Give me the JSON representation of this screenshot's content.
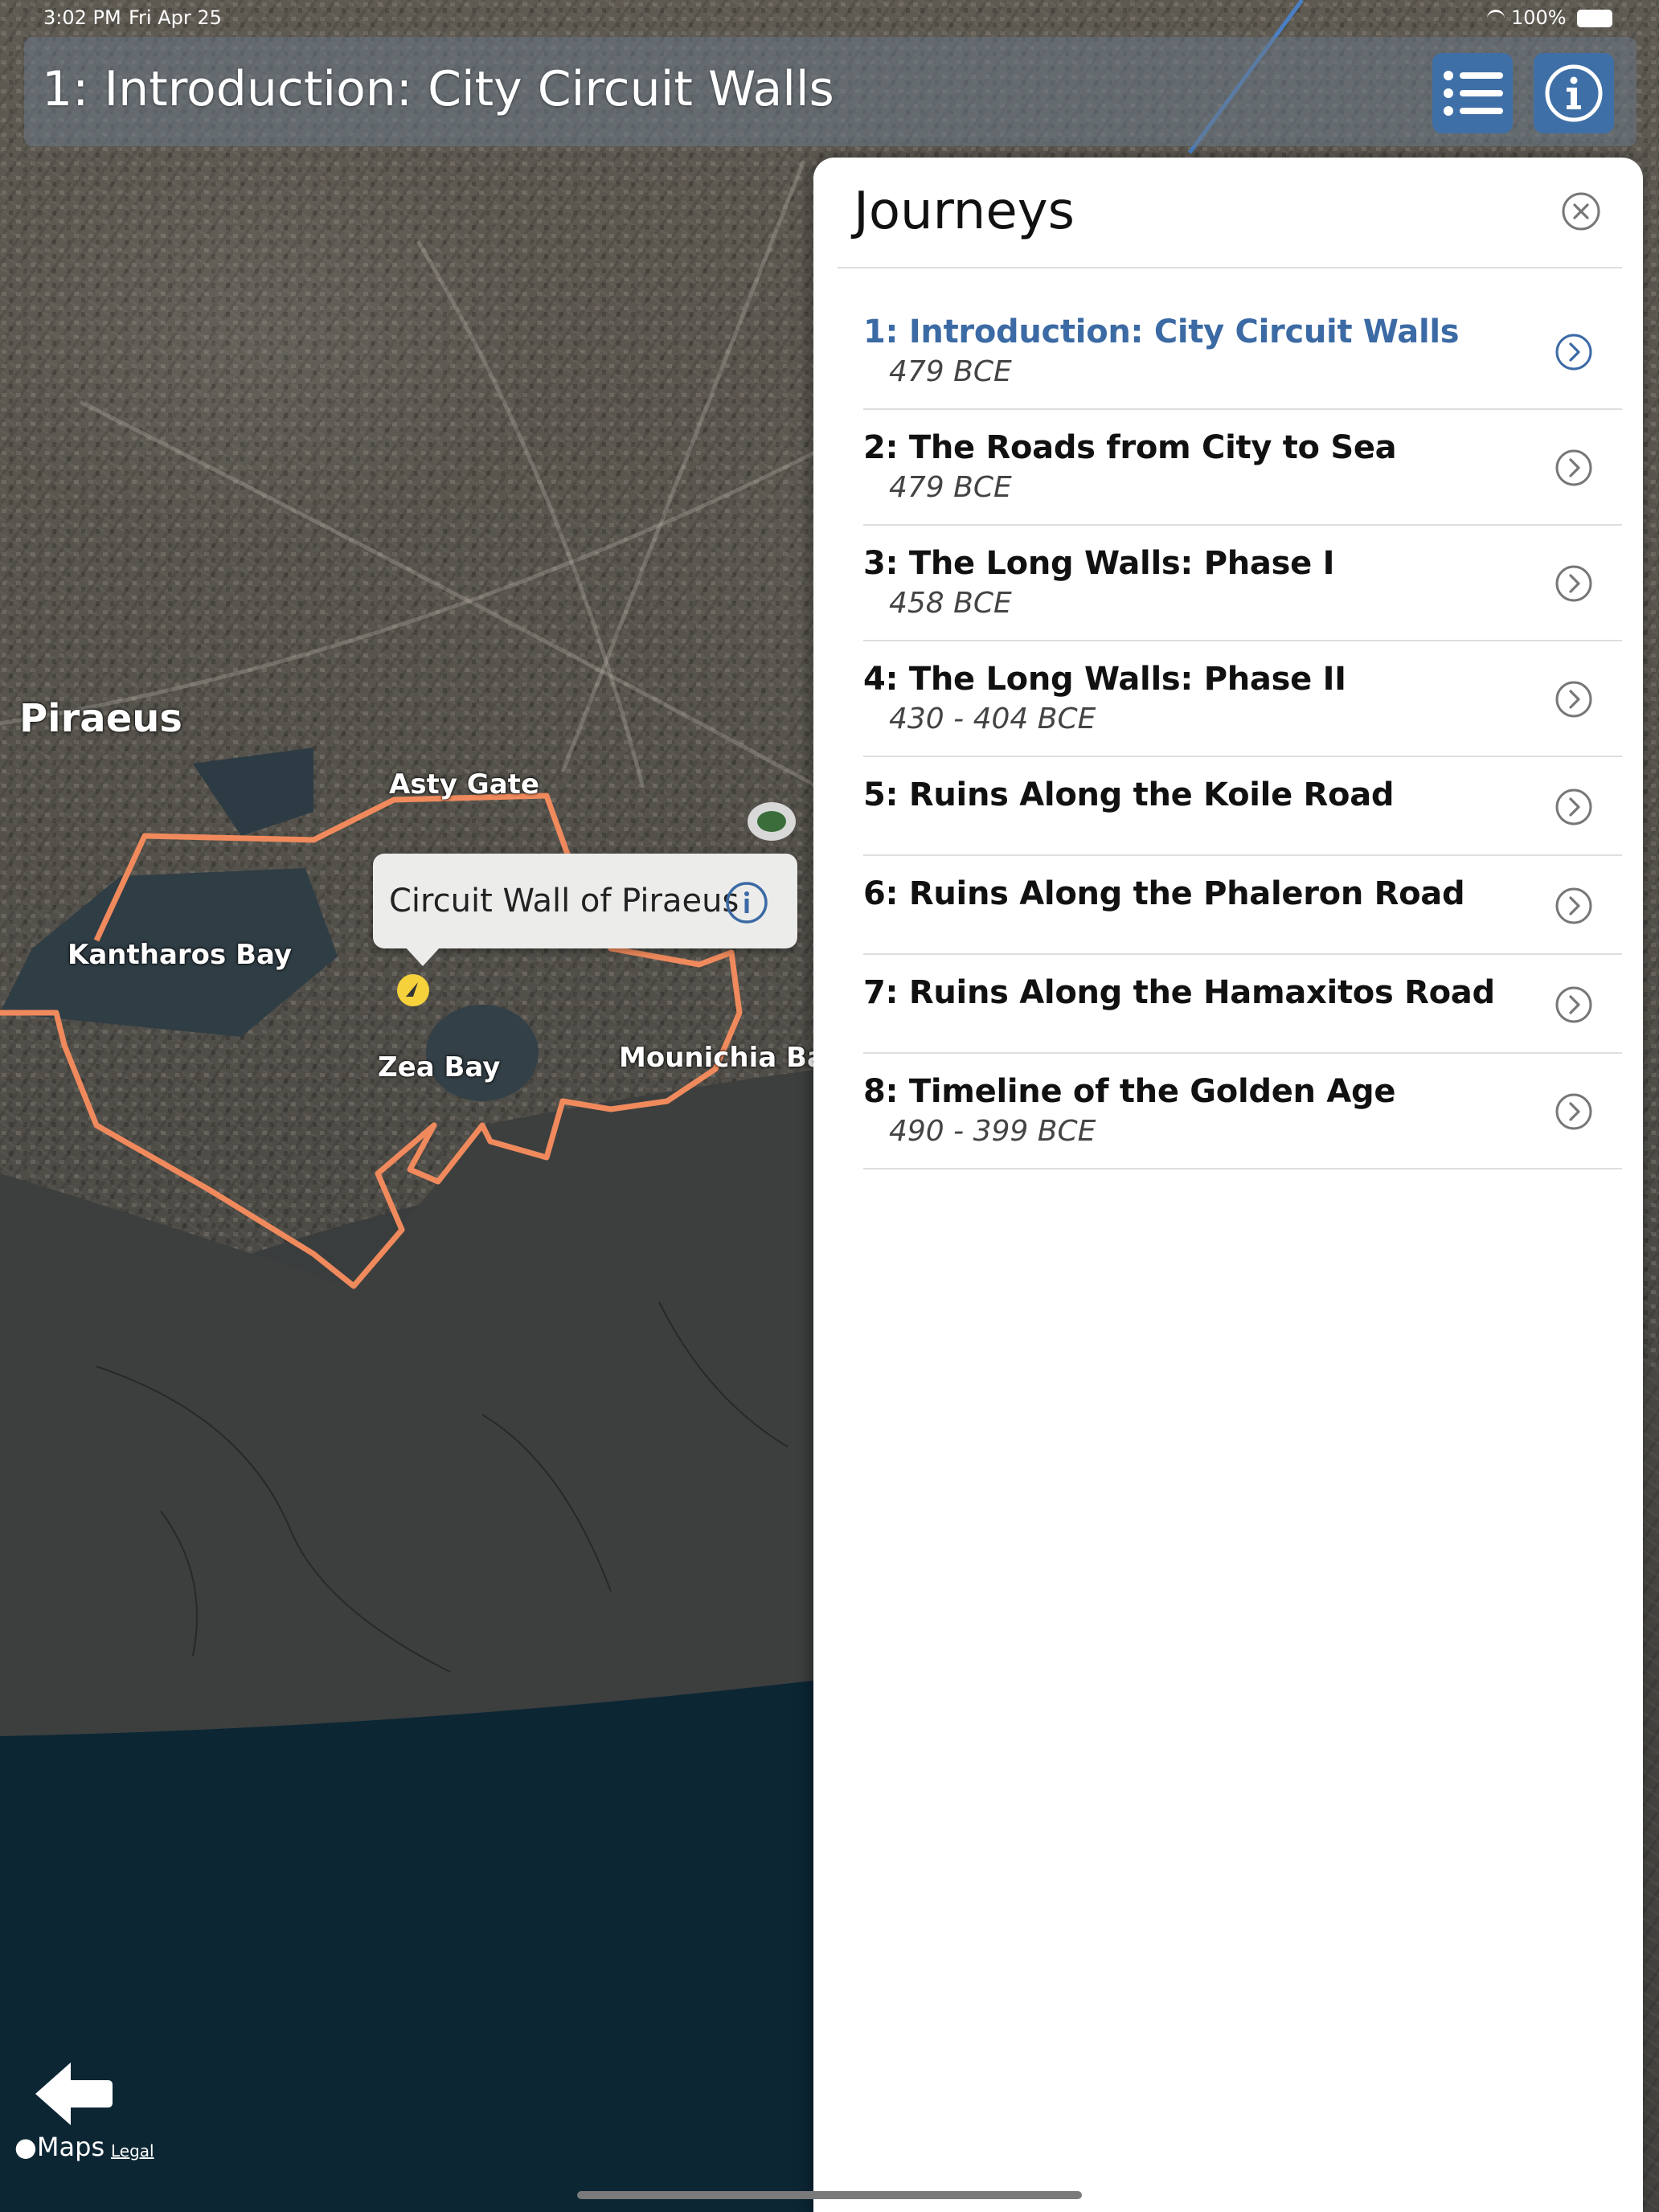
{
  "status_bar": {
    "time": "3:02 PM",
    "date": "Fri Apr 25",
    "battery": "100%"
  },
  "header": {
    "title": "1: Introduction: City Circuit Walls",
    "list_icon": "list-icon",
    "info_icon": "info-icon"
  },
  "map": {
    "labels": {
      "piraeus": "Piraeus",
      "asty_gate": "Asty Gate",
      "kantharos_bay": "Kantharos Bay",
      "zea_bay": "Zea Bay",
      "mounichia_bay": "Mounichia Ba"
    },
    "callout": {
      "text": "Circuit Wall of Piraeus",
      "info_icon": "info-icon"
    },
    "wall_color": "#f08a5d",
    "pin_color": "#f5d13c"
  },
  "journeys_panel": {
    "title": "Journeys",
    "close_icon": "close-circle-icon",
    "items": [
      {
        "title": "1: Introduction: City Circuit Walls",
        "date": "479 BCE",
        "active": true
      },
      {
        "title": "2: The Roads from City to Sea",
        "date": "479 BCE"
      },
      {
        "title": "3: The Long Walls: Phase I",
        "date": "458 BCE"
      },
      {
        "title": "4: The Long Walls: Phase II",
        "date": "430 - 404 BCE"
      },
      {
        "title": "5: Ruins Along the Koile Road",
        "date": ""
      },
      {
        "title": "6: Ruins Along the Phaleron Road",
        "date": ""
      },
      {
        "title": "7: Ruins Along the Hamaxitos Road",
        "date": ""
      },
      {
        "title": "8: Timeline of the Golden Age",
        "date": "490 - 399 BCE"
      }
    ],
    "accent_color": "#3b6aa4"
  },
  "footer": {
    "back_icon": "back-arrow-icon",
    "maps_label": "Maps",
    "legal_label": "Legal"
  }
}
